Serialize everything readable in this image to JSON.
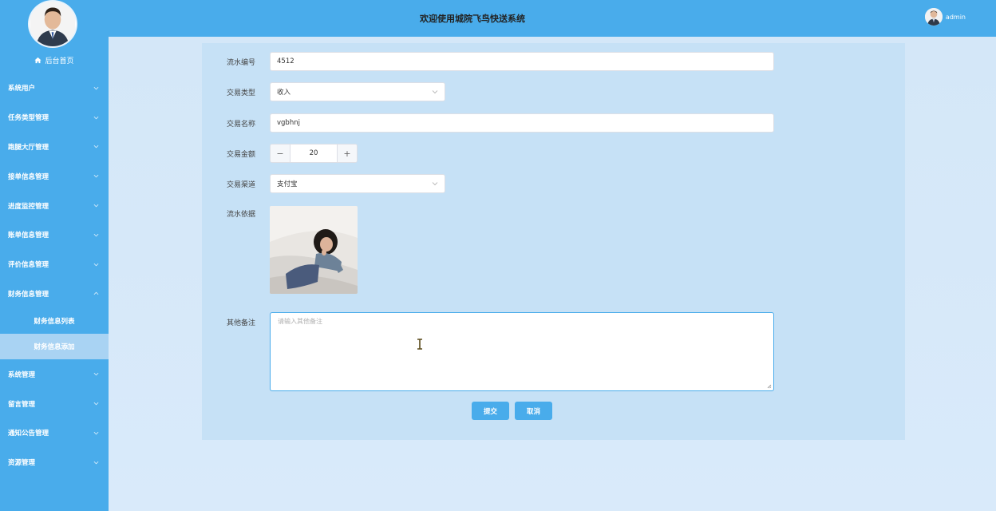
{
  "header": {
    "title": "欢迎使用城院飞鸟快送系统",
    "username": "admin"
  },
  "sidebar": {
    "home_label": "后台首页",
    "items": [
      {
        "label": "系统用户",
        "icon": "chevron-down-icon"
      },
      {
        "label": "任务类型管理",
        "icon": "chevron-down-icon"
      },
      {
        "label": "跑腿大厅管理",
        "icon": "chevron-down-icon"
      },
      {
        "label": "接单信息管理",
        "icon": "chevron-down-icon"
      },
      {
        "label": "进度监控管理",
        "icon": "chevron-down-icon"
      },
      {
        "label": "账单信息管理",
        "icon": "chevron-down-icon"
      },
      {
        "label": "评价信息管理",
        "icon": "chevron-down-icon"
      },
      {
        "label": "财务信息管理",
        "icon": "chevron-up-icon"
      },
      {
        "label": "系统管理",
        "icon": "chevron-down-icon"
      },
      {
        "label": "留言管理",
        "icon": "chevron-down-icon"
      },
      {
        "label": "通知公告管理",
        "icon": "chevron-down-icon"
      },
      {
        "label": "资源管理",
        "icon": "chevron-down-icon"
      }
    ],
    "submenu": [
      {
        "label": "财务信息列表",
        "active": false
      },
      {
        "label": "财务信息添加",
        "active": true
      }
    ]
  },
  "form": {
    "serial_label": "流水编号",
    "serial_value": "4512",
    "type_label": "交易类型",
    "type_value": "收入",
    "name_label": "交易名称",
    "name_value": "vgbhnj",
    "amount_label": "交易金额",
    "amount_value": "20",
    "amount_minus": "−",
    "amount_plus": "+",
    "channel_label": "交易渠道",
    "channel_value": "支付宝",
    "evidence_label": "流水依据",
    "notes_label": "其他备注",
    "notes_placeholder": "请输入其他备注",
    "submit_label": "提交",
    "cancel_label": "取消"
  },
  "colors": {
    "primary": "#49aceb",
    "panel": "#c6e1f6",
    "background": "#d6e8f8"
  }
}
